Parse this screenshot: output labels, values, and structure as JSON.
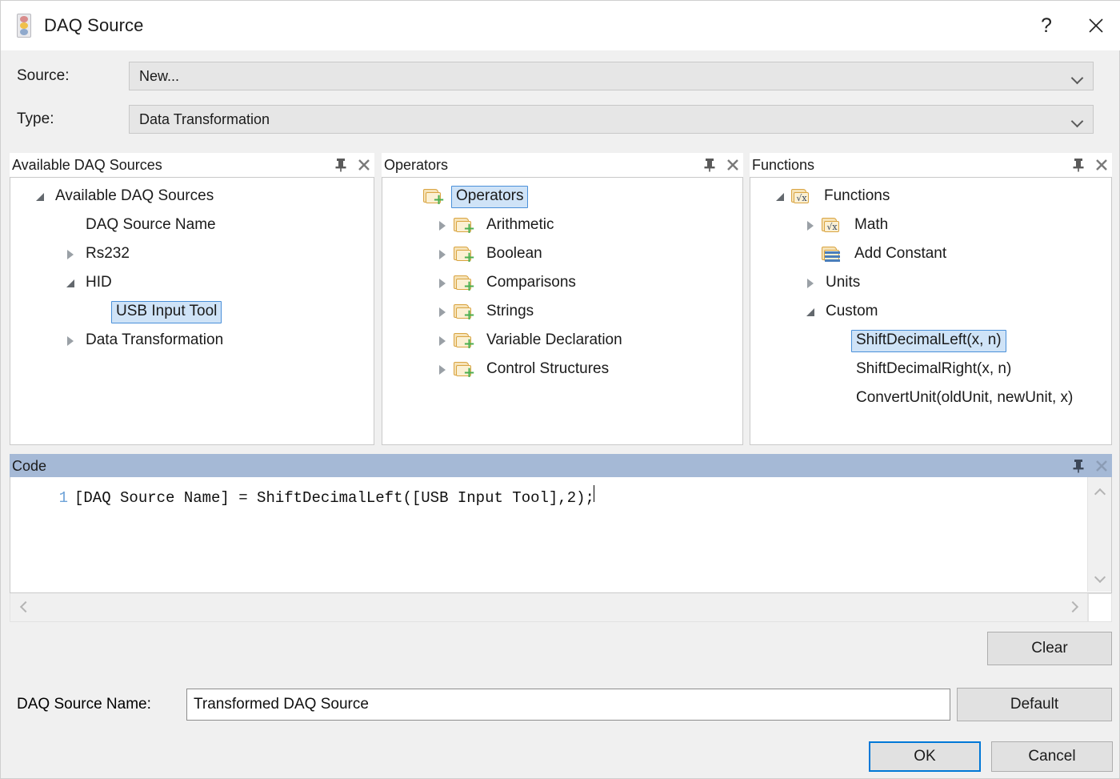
{
  "window": {
    "title": "DAQ Source",
    "icon": "traffic-light-icon",
    "help_label": "?",
    "close_label": "✕"
  },
  "fields": {
    "source": {
      "label": "Source:",
      "value": "New..."
    },
    "type": {
      "label": "Type:",
      "value": "Data Transformation"
    }
  },
  "panels": {
    "available": {
      "title": "Available DAQ Sources",
      "pin_icon": "pin-icon",
      "close_icon": "close-icon",
      "tree": [
        {
          "label": "Available DAQ Sources",
          "indent": 0,
          "state": "expanded",
          "icon": "none",
          "selected": false
        },
        {
          "label": "DAQ Source Name",
          "indent": 1,
          "state": "leaf",
          "icon": "none",
          "selected": false
        },
        {
          "label": "Rs232",
          "indent": 1,
          "state": "collapsed",
          "icon": "none",
          "selected": false
        },
        {
          "label": "HID",
          "indent": 1,
          "state": "expanded",
          "icon": "none",
          "selected": false
        },
        {
          "label": "USB Input Tool",
          "indent": 2,
          "state": "leaf",
          "icon": "none",
          "selected": true
        },
        {
          "label": "Data Transformation",
          "indent": 1,
          "state": "collapsed",
          "icon": "none",
          "selected": false
        }
      ]
    },
    "operators": {
      "title": "Operators",
      "pin_icon": "pin-icon",
      "close_icon": "close-icon",
      "tree": [
        {
          "label": "Operators",
          "indent": 0,
          "state": "leaf",
          "icon": "folder-plus",
          "selected": true
        },
        {
          "label": "Arithmetic",
          "indent": 1,
          "state": "collapsed",
          "icon": "folder-plus",
          "selected": false
        },
        {
          "label": "Boolean",
          "indent": 1,
          "state": "collapsed",
          "icon": "folder-plus",
          "selected": false
        },
        {
          "label": "Comparisons",
          "indent": 1,
          "state": "collapsed",
          "icon": "folder-plus",
          "selected": false
        },
        {
          "label": "Strings",
          "indent": 1,
          "state": "collapsed",
          "icon": "folder-plus",
          "selected": false
        },
        {
          "label": "Variable Declaration",
          "indent": 1,
          "state": "collapsed",
          "icon": "folder-plus",
          "selected": false
        },
        {
          "label": "Control Structures",
          "indent": 1,
          "state": "collapsed",
          "icon": "folder-plus",
          "selected": false
        }
      ]
    },
    "functions": {
      "title": "Functions",
      "pin_icon": "pin-icon",
      "close_icon": "close-icon",
      "tree": [
        {
          "label": "Functions",
          "indent": 0,
          "state": "expanded",
          "icon": "folder-sqrt",
          "selected": false
        },
        {
          "label": "Math",
          "indent": 1,
          "state": "collapsed",
          "icon": "folder-sqrt",
          "selected": false
        },
        {
          "label": "Add Constant",
          "indent": 1,
          "state": "leaf",
          "icon": "folder-bars",
          "selected": false
        },
        {
          "label": "Units",
          "indent": 1,
          "state": "collapsed",
          "icon": "none",
          "selected": false
        },
        {
          "label": "Custom",
          "indent": 1,
          "state": "expanded",
          "icon": "none",
          "selected": false
        },
        {
          "label": "ShiftDecimalLeft(x, n)",
          "indent": 2,
          "state": "leaf",
          "icon": "none",
          "selected": true
        },
        {
          "label": "ShiftDecimalRight(x, n)",
          "indent": 2,
          "state": "leaf",
          "icon": "none",
          "selected": false
        },
        {
          "label": "ConvertUnit(oldUnit, newUnit, x)",
          "indent": 2,
          "state": "leaf",
          "icon": "none",
          "selected": false
        }
      ]
    },
    "code": {
      "title": "Code",
      "pin_icon": "pin-icon",
      "close_icon": "close-icon",
      "line_number": "1",
      "line_text": "[DAQ Source Name] = ShiftDecimalLeft([USB Input Tool],2);"
    }
  },
  "buttons": {
    "clear": "Clear",
    "default": "Default",
    "ok": "OK",
    "cancel": "Cancel"
  },
  "daq_source_name": {
    "label": "DAQ Source Name:",
    "value": "Transformed DAQ Source"
  },
  "colors": {
    "selection_fill": "#cfe3f7",
    "selection_border": "#4a90d9",
    "active_panel_header": "#a5b9d6",
    "focus_border": "#0078d7",
    "gutter_text": "#6ea3d8",
    "dialog_background": "#f0f0f0"
  }
}
